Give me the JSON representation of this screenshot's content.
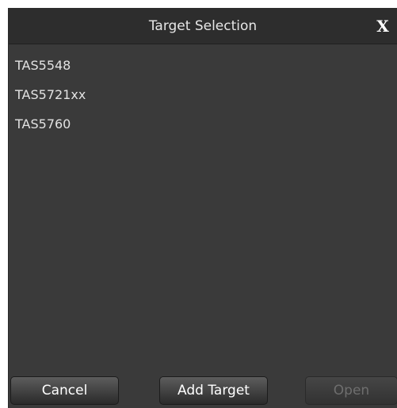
{
  "dialog": {
    "title": "Target Selection",
    "close_label": "X"
  },
  "targets": [
    "TAS5548",
    "TAS5721xx",
    "TAS5760"
  ],
  "footer": {
    "cancel_label": "Cancel",
    "add_target_label": "Add Target",
    "open_label": "Open"
  }
}
